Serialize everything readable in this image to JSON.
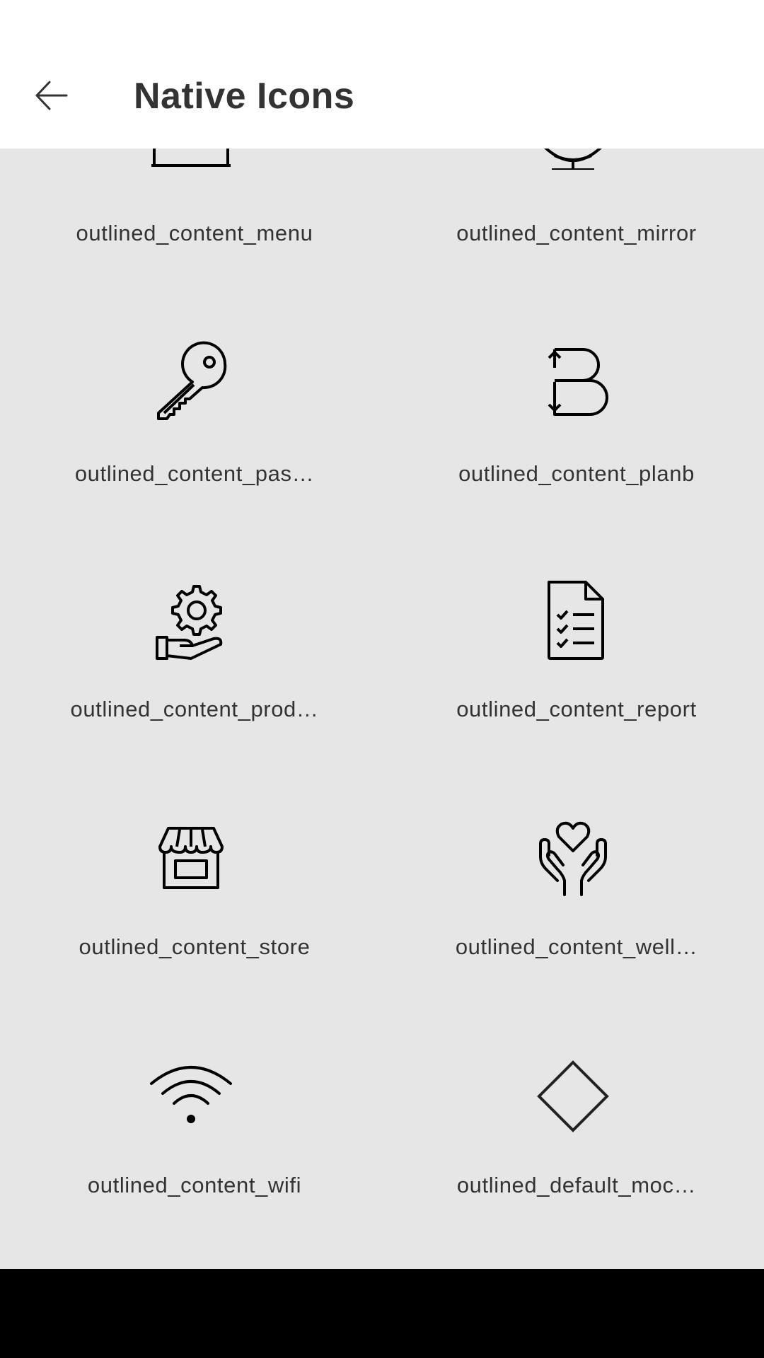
{
  "header": {
    "title": "Native Icons",
    "back_icon": "arrow-left-icon"
  },
  "grid": {
    "items": [
      {
        "label": "outlined_content_menu",
        "icon": "menu-icon"
      },
      {
        "label": "outlined_content_mirror",
        "icon": "mirror-icon"
      },
      {
        "label": "outlined_content_pas…",
        "icon": "key-icon"
      },
      {
        "label": "outlined_content_planb",
        "icon": "planb-icon"
      },
      {
        "label": "outlined_content_prod…",
        "icon": "gear-hand-icon"
      },
      {
        "label": "outlined_content_report",
        "icon": "report-icon"
      },
      {
        "label": "outlined_content_store",
        "icon": "store-icon"
      },
      {
        "label": "outlined_content_well…",
        "icon": "wellness-icon"
      },
      {
        "label": "outlined_content_wifi",
        "icon": "wifi-icon"
      },
      {
        "label": "outlined_default_moc…",
        "icon": "diamond-icon"
      }
    ]
  },
  "colors": {
    "app_bar": "#ffffff",
    "background": "#e6e6e6",
    "text": "#333333",
    "nav_bar": "#000000"
  }
}
